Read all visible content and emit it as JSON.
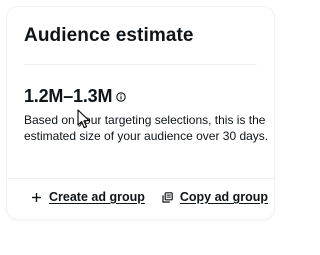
{
  "card": {
    "title": "Audience estimate",
    "estimate": "1.2M–1.3M",
    "info_icon": "info-icon",
    "description": "Based on your targeting selections, this is the estimated size of your audience over 30 days."
  },
  "actions": {
    "create_label": "Create ad group",
    "create_icon": "plus-icon",
    "copy_label": "Copy ad group",
    "copy_icon": "copy-icon"
  },
  "colors": {
    "text": "#0f1419",
    "border": "#eff3f4",
    "background": "#ffffff"
  }
}
